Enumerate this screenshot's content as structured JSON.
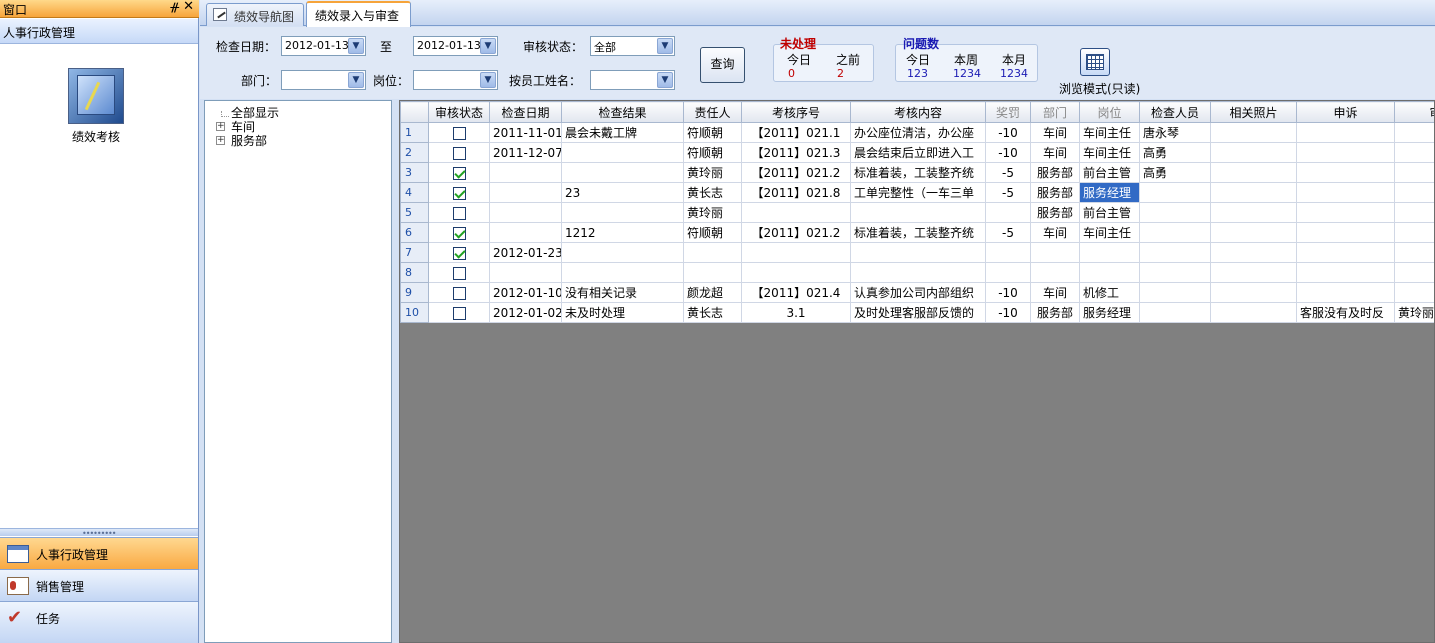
{
  "window": {
    "title": "窗口",
    "pin_glyph": "ᚌ",
    "close_glyph": "✕"
  },
  "left": {
    "group_title": "人事行政管理",
    "module_label": "绩效考核",
    "nav": [
      {
        "label": "人事行政管理",
        "icon": "calendar-icon"
      },
      {
        "label": "销售管理",
        "icon": "contact-card-icon"
      },
      {
        "label": "任务",
        "icon": "task-check-icon"
      }
    ]
  },
  "tabs": {
    "nav_label": "绩效导航图",
    "entry_label": "绩效录入与审查"
  },
  "filters": {
    "date_label": "检查日期：",
    "date_from": "2012-01-13",
    "to_label": "至",
    "date_to": "2012-01-13",
    "status_label": "审核状态：",
    "status_value": "全部",
    "dept_label": "部门：",
    "dept_value": "",
    "post_label": "岗位：",
    "post_value": "",
    "name_label": "按员工姓名：",
    "name_value": "",
    "query_label": "查询",
    "browse_label": "浏览模式(只读)"
  },
  "unprocessed": {
    "title": "未处理",
    "title_color": "#c00000",
    "labels": [
      "今日",
      "之前"
    ],
    "values": [
      "0",
      "2"
    ]
  },
  "issues": {
    "title": "问题数",
    "title_color": "#1a1ab3",
    "labels": [
      "今日",
      "本周",
      "本月"
    ],
    "values": [
      "123",
      "1234",
      "1234"
    ]
  },
  "tree": {
    "items": [
      "全部显示",
      "车间",
      "服务部"
    ]
  },
  "grid": {
    "columns": [
      "审核状态",
      "检查日期",
      "检查结果",
      "责任人",
      "考核序号",
      "考核内容",
      "奖罚",
      "部门",
      "岗位",
      "检查人员",
      "相关照片",
      "申诉",
      "审核表"
    ],
    "rows": [
      {
        "n": "1",
        "checked": false,
        "date": "2011-11-01",
        "result": "晨会未戴工牌",
        "person": "符顺朝",
        "seq": "【2011】021.1",
        "content": "办公座位清洁，办公座",
        "reward": "-10",
        "dept": "车间",
        "post": "车间主任",
        "inspector": "唐永琴",
        "photo": "",
        "appeal": "",
        "audit": ""
      },
      {
        "n": "2",
        "checked": false,
        "date": "2011-12-07",
        "result": "",
        "person": "符顺朝",
        "seq": "【2011】021.3",
        "content": "晨会结束后立即进入工",
        "reward": "-10",
        "dept": "车间",
        "post": "车间主任",
        "inspector": "高勇",
        "photo": "",
        "appeal": "",
        "audit": ""
      },
      {
        "n": "3",
        "checked": true,
        "date": "",
        "result": "",
        "person": "黄玲丽",
        "seq": "【2011】021.2",
        "content": "标准着装，工装整齐统",
        "reward": "-5",
        "dept": "服务部",
        "post": "前台主管",
        "inspector": "高勇",
        "photo": "",
        "appeal": "",
        "audit": ""
      },
      {
        "n": "4",
        "checked": true,
        "date": "",
        "result": "23",
        "person": "黄长志",
        "seq": "【2011】021.8",
        "content": "工单完整性（一车三单",
        "reward": "-5",
        "dept": "服务部",
        "post": "服务经理",
        "inspector": "",
        "photo": "",
        "appeal": "",
        "audit": ""
      },
      {
        "n": "5",
        "checked": false,
        "date": "",
        "result": "",
        "person": "黄玲丽",
        "seq": "",
        "content": "",
        "reward": "",
        "dept": "服务部",
        "post": "前台主管",
        "inspector": "",
        "photo": "",
        "appeal": "",
        "audit": ""
      },
      {
        "n": "6",
        "checked": true,
        "date": "",
        "result": "1212",
        "person": "符顺朝",
        "seq": "【2011】021.2",
        "content": "标准着装，工装整齐统",
        "reward": "-5",
        "dept": "车间",
        "post": "车间主任",
        "inspector": "",
        "photo": "",
        "appeal": "",
        "audit": ""
      },
      {
        "n": "7",
        "checked": true,
        "date": "2012-01-23",
        "result": "",
        "person": "",
        "seq": "",
        "content": "",
        "reward": "",
        "dept": "",
        "post": "",
        "inspector": "",
        "photo": "",
        "appeal": "",
        "audit": ""
      },
      {
        "n": "8",
        "checked": false,
        "date": "",
        "result": "",
        "person": "",
        "seq": "",
        "content": "",
        "reward": "",
        "dept": "",
        "post": "",
        "inspector": "",
        "photo": "",
        "appeal": "",
        "audit": ""
      },
      {
        "n": "9",
        "checked": false,
        "date": "2012-01-10",
        "result": "没有相关记录",
        "person": "颜龙超",
        "seq": "【2011】021.4",
        "content": "认真参加公司内部组织",
        "reward": "-10",
        "dept": "车间",
        "post": "机修工",
        "inspector": "",
        "photo": "",
        "appeal": "",
        "audit": ""
      },
      {
        "n": "10",
        "checked": false,
        "date": "2012-01-02",
        "result": "未及时处理",
        "person": "黄长志",
        "seq": "3.1",
        "content": "及时处理客服部反馈的",
        "reward": "-10",
        "dept": "服务部",
        "post": "服务经理",
        "inspector": "",
        "photo": "",
        "appeal": "客服没有及时反",
        "audit": "黄玲丽"
      }
    ],
    "selected_cell": {
      "row": 4,
      "field": "post"
    }
  }
}
